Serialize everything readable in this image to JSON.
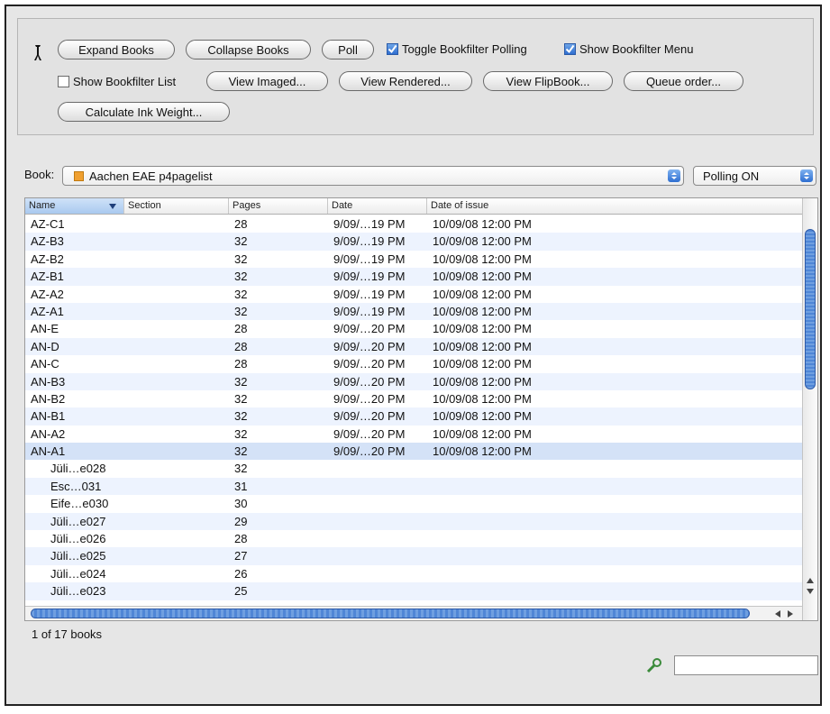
{
  "toolbar": {
    "expand_label": "Expand Books",
    "collapse_label": "Collapse Books",
    "poll_label": "Poll",
    "toggle_polling_label": "Toggle Bookfilter Polling",
    "toggle_polling_checked": true,
    "show_menu_label": "Show Bookfilter Menu",
    "show_menu_checked": true,
    "show_list_label": "Show Bookfilter List",
    "show_list_checked": false,
    "view_imaged_label": "View Imaged...",
    "view_rendered_label": "View Rendered...",
    "view_flipbook_label": "View FlipBook...",
    "queue_order_label": "Queue order...",
    "calc_ink_label": "Calculate Ink Weight..."
  },
  "book_selector": {
    "label": "Book:",
    "value": "Aachen EAE p4pagelist",
    "icon_color": "#f0a030",
    "polling_value": "Polling ON"
  },
  "table": {
    "columns": [
      "Name",
      "Section",
      "Pages",
      "Date",
      "Date of issue"
    ],
    "sorted_column": "Name",
    "rows": [
      {
        "name": "AZ-C1",
        "pages": "28",
        "date": "9/09/…19 PM",
        "issue": "10/09/08 12:00 PM"
      },
      {
        "name": "AZ-B3",
        "pages": "32",
        "date": "9/09/…19 PM",
        "issue": "10/09/08 12:00 PM"
      },
      {
        "name": "AZ-B2",
        "pages": "32",
        "date": "9/09/…19 PM",
        "issue": "10/09/08 12:00 PM"
      },
      {
        "name": "AZ-B1",
        "pages": "32",
        "date": "9/09/…19 PM",
        "issue": "10/09/08 12:00 PM"
      },
      {
        "name": "AZ-A2",
        "pages": "32",
        "date": "9/09/…19 PM",
        "issue": "10/09/08 12:00 PM"
      },
      {
        "name": "AZ-A1",
        "pages": "32",
        "date": "9/09/…19 PM",
        "issue": "10/09/08 12:00 PM"
      },
      {
        "name": "AN-E",
        "pages": "28",
        "date": "9/09/…20 PM",
        "issue": "10/09/08 12:00 PM"
      },
      {
        "name": "AN-D",
        "pages": "28",
        "date": "9/09/…20 PM",
        "issue": "10/09/08 12:00 PM"
      },
      {
        "name": "AN-C",
        "pages": "28",
        "date": "9/09/…20 PM",
        "issue": "10/09/08 12:00 PM"
      },
      {
        "name": "AN-B3",
        "pages": "32",
        "date": "9/09/…20 PM",
        "issue": "10/09/08 12:00 PM"
      },
      {
        "name": "AN-B2",
        "pages": "32",
        "date": "9/09/…20 PM",
        "issue": "10/09/08 12:00 PM"
      },
      {
        "name": "AN-B1",
        "pages": "32",
        "date": "9/09/…20 PM",
        "issue": "10/09/08 12:00 PM"
      },
      {
        "name": "AN-A2",
        "pages": "32",
        "date": "9/09/…20 PM",
        "issue": "10/09/08 12:00 PM"
      },
      {
        "name": "AN-A1",
        "pages": "32",
        "date": "9/09/…20 PM",
        "issue": "10/09/08 12:00 PM",
        "selected": true
      },
      {
        "name": "Jüli…e028",
        "pages": "32",
        "date": "",
        "issue": "",
        "child": true
      },
      {
        "name": "Esc…031",
        "pages": "31",
        "date": "",
        "issue": "",
        "child": true
      },
      {
        "name": "Eife…e030",
        "pages": "30",
        "date": "",
        "issue": "",
        "child": true
      },
      {
        "name": "Jüli…e027",
        "pages": "29",
        "date": "",
        "issue": "",
        "child": true
      },
      {
        "name": "Jüli…e026",
        "pages": "28",
        "date": "",
        "issue": "",
        "child": true
      },
      {
        "name": "Jüli…e025",
        "pages": "27",
        "date": "",
        "issue": "",
        "child": true
      },
      {
        "name": "Jüli…e024",
        "pages": "26",
        "date": "",
        "issue": "",
        "child": true
      },
      {
        "name": "Jüli…e023",
        "pages": "25",
        "date": "",
        "issue": "",
        "child": true
      }
    ]
  },
  "status": {
    "text": "1 of 17 books"
  },
  "search": {
    "value": ""
  },
  "colors": {
    "alt_row": "#edf3fe",
    "selected_row": "#d4e2f7",
    "accent": "#2f6fd0"
  }
}
